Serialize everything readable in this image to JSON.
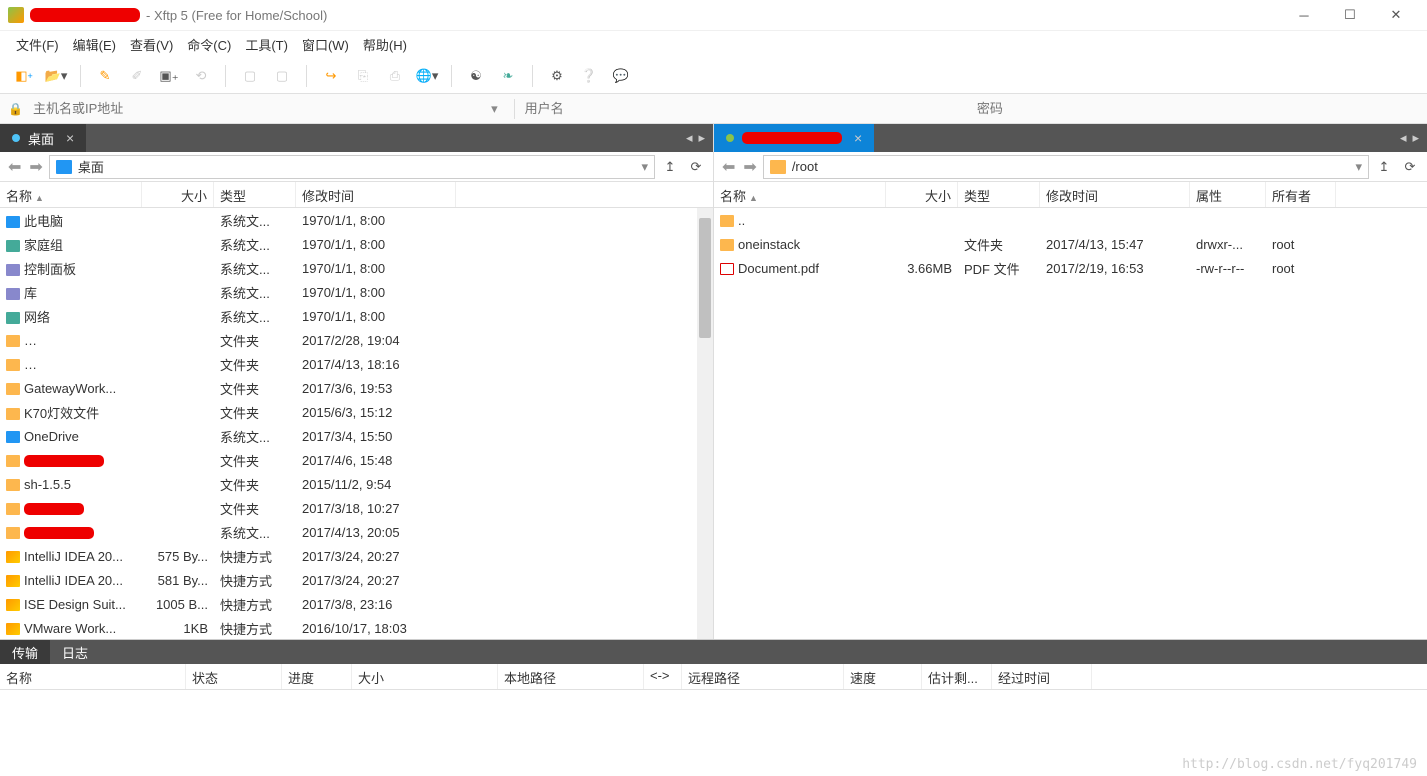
{
  "title": " - Xftp 5 (Free for Home/School)",
  "menu": [
    "文件(F)",
    "编辑(E)",
    "查看(V)",
    "命令(C)",
    "工具(T)",
    "窗口(W)",
    "帮助(H)"
  ],
  "addr": {
    "host_ph": "主机名或IP地址",
    "user_ph": "用户名",
    "pass_ph": "密码"
  },
  "left": {
    "tab": "桌面",
    "path": "桌面",
    "cols": [
      "名称",
      "大小",
      "类型",
      "修改时间"
    ],
    "rows": [
      {
        "ico": "ico-pc",
        "n": "此电脑",
        "s": "",
        "t": "系统文...",
        "d": "1970/1/1, 8:00"
      },
      {
        "ico": "ico-net",
        "n": "家庭组",
        "s": "",
        "t": "系统文...",
        "d": "1970/1/1, 8:00"
      },
      {
        "ico": "ico-lib",
        "n": "控制面板",
        "s": "",
        "t": "系统文...",
        "d": "1970/1/1, 8:00"
      },
      {
        "ico": "ico-lib",
        "n": "库",
        "s": "",
        "t": "系统文...",
        "d": "1970/1/1, 8:00"
      },
      {
        "ico": "ico-net",
        "n": "网络",
        "s": "",
        "t": "系统文...",
        "d": "1970/1/1, 8:00"
      },
      {
        "ico": "ico-folder",
        "red": 130,
        "n": "",
        "s": "",
        "t": "文件夹",
        "d": "2017/2/28, 19:04"
      },
      {
        "ico": "ico-folder",
        "red": 150,
        "n": "",
        "s": "",
        "t": "文件夹",
        "d": "2017/4/13, 18:16"
      },
      {
        "ico": "ico-folder",
        "n": "GatewayWork...",
        "s": "",
        "t": "文件夹",
        "d": "2017/3/6, 19:53"
      },
      {
        "ico": "ico-folder",
        "n": "K70灯效文件",
        "s": "",
        "t": "文件夹",
        "d": "2015/6/3, 15:12"
      },
      {
        "ico": "ico-cloud",
        "n": "OneDrive",
        "s": "",
        "t": "系统文...",
        "d": "2017/3/4, 15:50"
      },
      {
        "ico": "ico-folder",
        "red": 80,
        "n": "",
        "s": "",
        "t": "文件夹",
        "d": "2017/4/6, 15:48"
      },
      {
        "ico": "ico-folder",
        "n": "sh-1.5.5",
        "s": "",
        "t": "文件夹",
        "d": "2015/11/2, 9:54"
      },
      {
        "ico": "ico-folder",
        "red": 60,
        "n": "",
        "s": "",
        "t": "文件夹",
        "d": "2017/3/18, 10:27"
      },
      {
        "ico": "ico-folder",
        "red": 70,
        "n": "",
        "s": "",
        "t": "系统文...",
        "d": "2017/4/13, 20:05"
      },
      {
        "ico": "ico-lnk",
        "n": "IntelliJ IDEA 20...",
        "s": "575 By...",
        "t": "快捷方式",
        "d": "2017/3/24, 20:27"
      },
      {
        "ico": "ico-lnk",
        "n": "IntelliJ IDEA 20...",
        "s": "581 By...",
        "t": "快捷方式",
        "d": "2017/3/24, 20:27"
      },
      {
        "ico": "ico-lnk",
        "n": "ISE Design Suit...",
        "s": "1005 B...",
        "t": "快捷方式",
        "d": "2017/3/8, 23:16"
      },
      {
        "ico": "ico-lnk",
        "n": "VMware Work...",
        "s": "1KB",
        "t": "快捷方式",
        "d": "2016/10/17, 18:03"
      }
    ]
  },
  "right": {
    "path": "/root",
    "cols": [
      "名称",
      "大小",
      "类型",
      "修改时间",
      "属性",
      "所有者"
    ],
    "rows": [
      {
        "ico": "ico-folder",
        "n": "..",
        "s": "",
        "t": "",
        "d": "",
        "a": "",
        "o": ""
      },
      {
        "ico": "ico-folder",
        "n": "oneinstack",
        "s": "",
        "t": "文件夹",
        "d": "2017/4/13, 15:47",
        "a": "drwxr-...",
        "o": "root"
      },
      {
        "ico": "ico-pdf",
        "n": "Document.pdf",
        "s": "3.66MB",
        "t": "PDF 文件",
        "d": "2017/2/19, 16:53",
        "a": "-rw-r--r--",
        "o": "root"
      }
    ]
  },
  "bottom": {
    "tabs": [
      "传输",
      "日志"
    ],
    "cols": [
      "名称",
      "状态",
      "进度",
      "大小",
      "本地路径",
      "<->",
      "远程路径",
      "速度",
      "估计剩...",
      "经过时间"
    ]
  },
  "watermark": "http://blog.csdn.net/fyq201749"
}
